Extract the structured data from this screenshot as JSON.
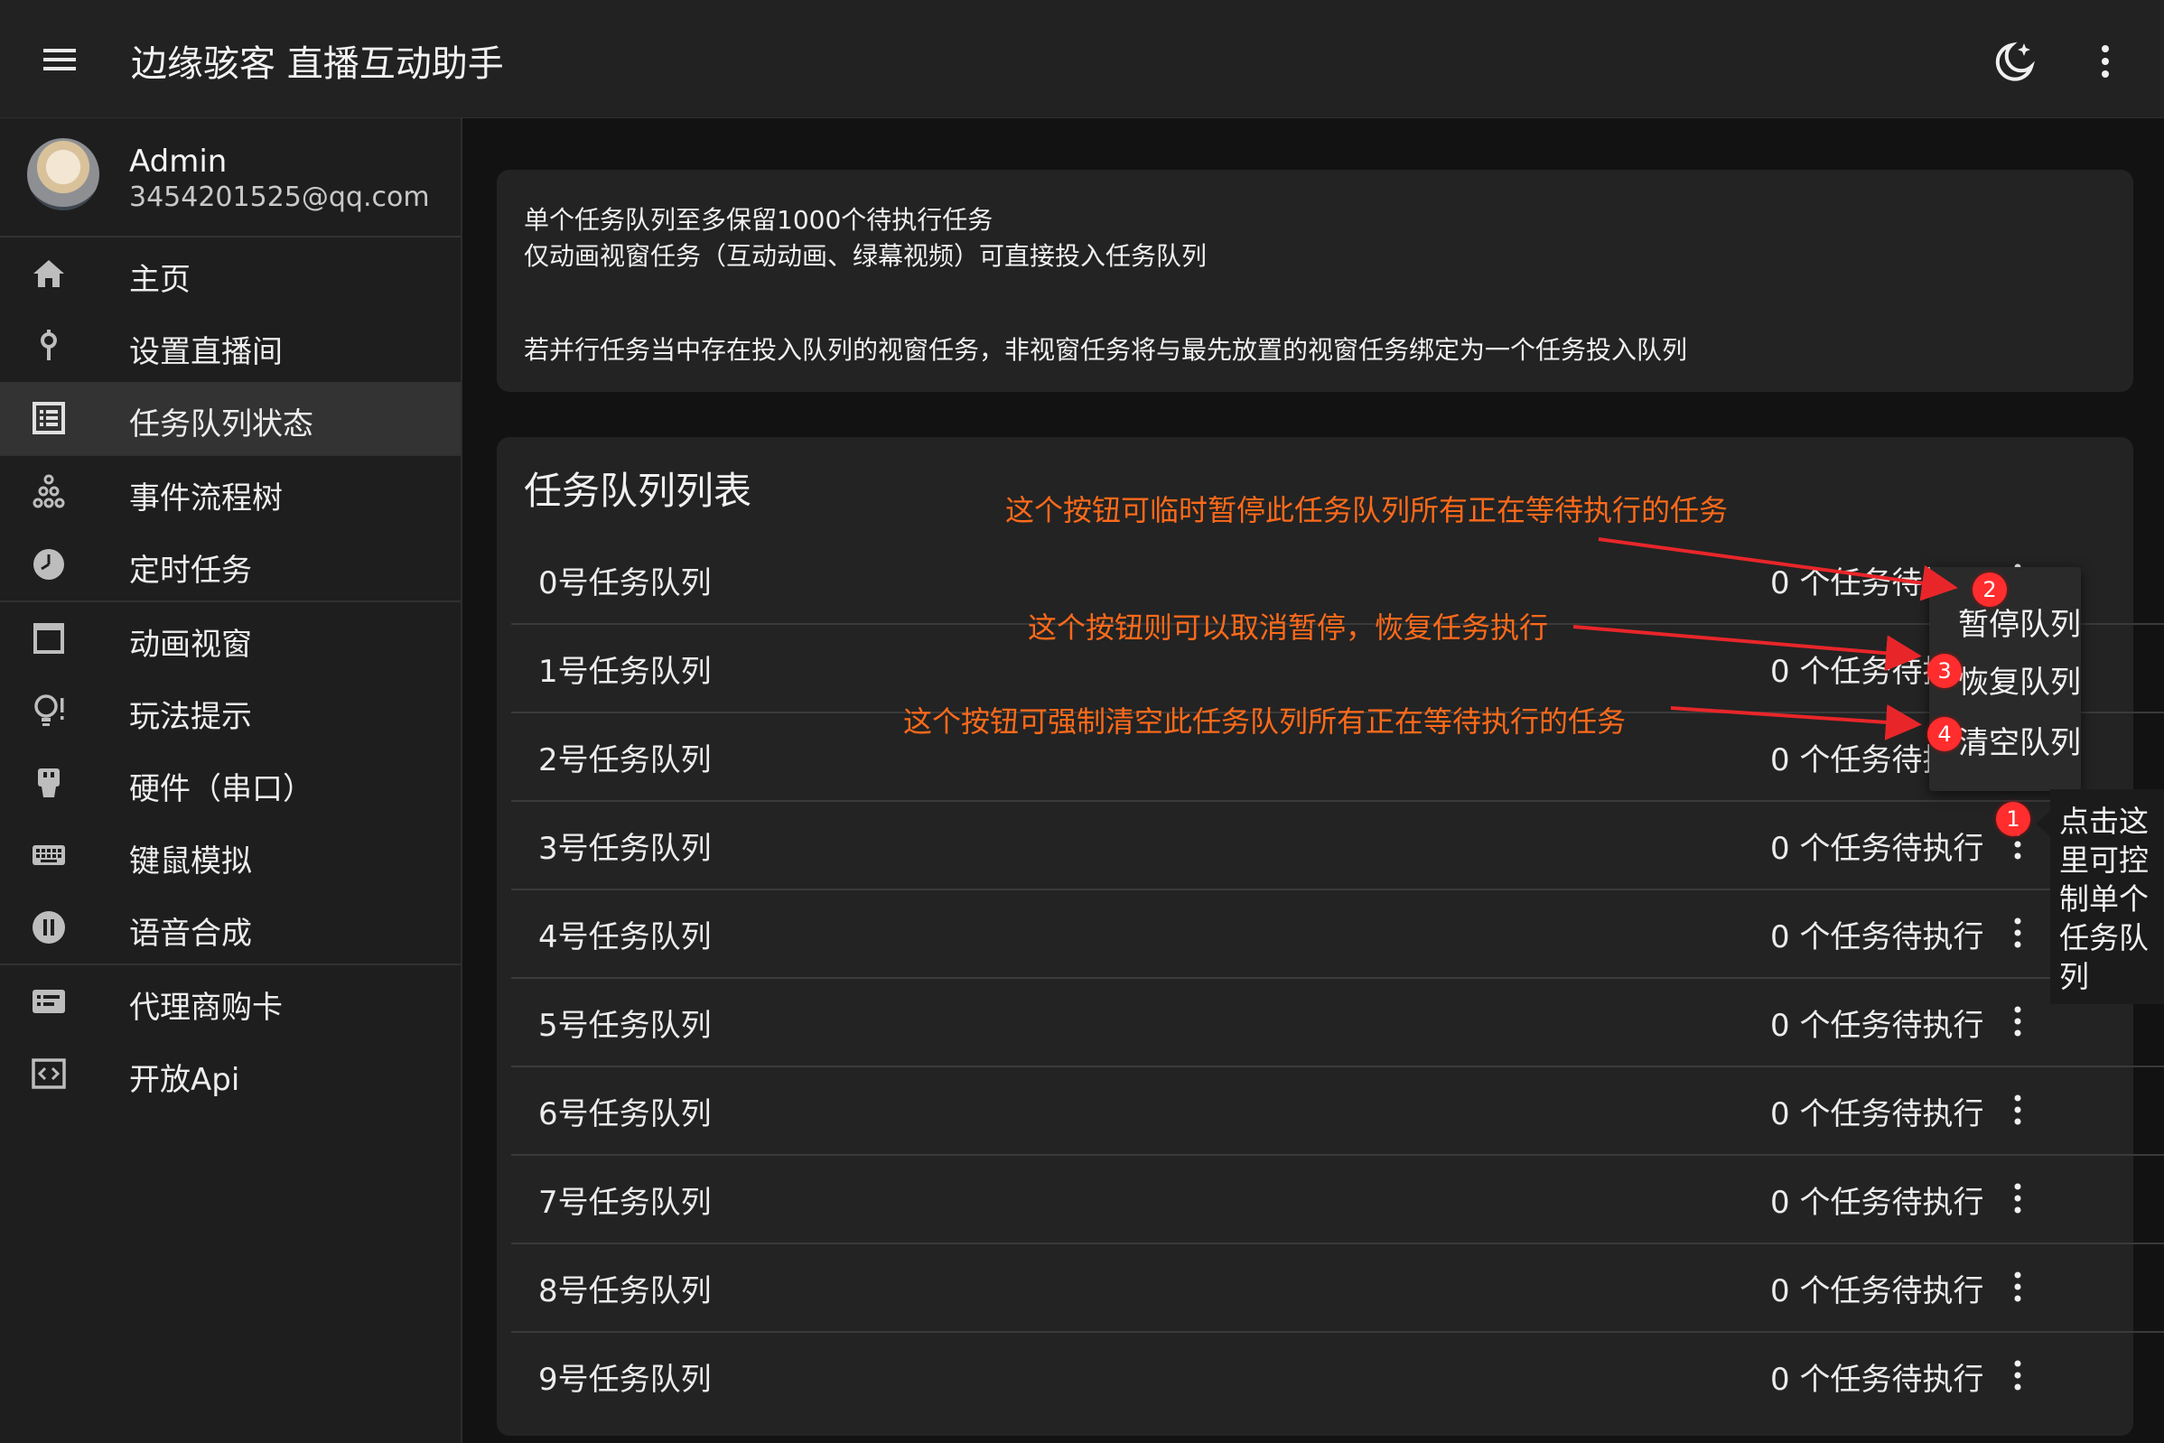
{
  "header": {
    "title": "边缘骇客 直播互动助手",
    "menu_icon": "hamburger-icon",
    "theme_icon": "moon-star-icon",
    "more_icon": "more-vert-icon"
  },
  "profile": {
    "name": "Admin",
    "email": "3454201525@qq.com"
  },
  "sidebar": {
    "items": [
      {
        "label": "主页",
        "icon": "home-icon"
      },
      {
        "label": "设置直播间",
        "icon": "key-icon"
      },
      {
        "label": "任务队列状态",
        "icon": "list-icon"
      },
      {
        "label": "事件流程树",
        "icon": "tree-icon"
      },
      {
        "label": "定时任务",
        "icon": "clock-icon"
      },
      {
        "label": "动画视窗",
        "icon": "window-icon"
      },
      {
        "label": "玩法提示",
        "icon": "lightbulb-icon"
      },
      {
        "label": "硬件（串口）",
        "icon": "usb-icon"
      },
      {
        "label": "键鼠模拟",
        "icon": "keyboard-icon"
      },
      {
        "label": "语音合成",
        "icon": "voice-icon"
      },
      {
        "label": "代理商购卡",
        "icon": "card-icon"
      },
      {
        "label": "开放Api",
        "icon": "code-icon"
      }
    ],
    "active_index": 2
  },
  "info": {
    "line1": "单个任务队列至多保留1000个待执行任务",
    "line2": "仅动画视窗任务（互动动画、绿幕视频）可直接投入任务队列",
    "line3": "若并行任务当中存在投入队列的视窗任务，非视窗任务将与最先放置的视窗任务绑定为一个任务投入队列"
  },
  "queue_list": {
    "title": "任务队列列表",
    "rows": [
      {
        "name": "0号任务队列",
        "count": "0 个任务待执行"
      },
      {
        "name": "1号任务队列",
        "count": "0 个任务待执行"
      },
      {
        "name": "2号任务队列",
        "count": "0 个任务待执行"
      },
      {
        "name": "3号任务队列",
        "count": "0 个任务待执行"
      },
      {
        "name": "4号任务队列",
        "count": "0 个任务待执行"
      },
      {
        "name": "5号任务队列",
        "count": "0 个任务待执行"
      },
      {
        "name": "6号任务队列",
        "count": "0 个任务待执行"
      },
      {
        "name": "7号任务队列",
        "count": "0 个任务待执行"
      },
      {
        "name": "8号任务队列",
        "count": "0 个任务待执行"
      },
      {
        "name": "9号任务队列",
        "count": "0 个任务待执行"
      }
    ]
  },
  "dropdown": {
    "pause": "暂停队列",
    "resume": "恢复队列",
    "clear": "清空队列"
  },
  "tooltip": {
    "text": "点击这里可控制单个任务队列"
  },
  "annotations": {
    "pause": "这个按钮可临时暂停此任务队列所有正在等待执行的任务",
    "resume": "这个按钮则可以取消暂停，恢复任务执行",
    "clear": "这个按钮可强制清空此任务队列所有正在等待执行的任务",
    "badges": [
      "1",
      "2",
      "3",
      "4"
    ]
  },
  "colors": {
    "annotation": "#ff6a1a",
    "badge": "#ff2d2d",
    "arrow": "#e8262a"
  }
}
